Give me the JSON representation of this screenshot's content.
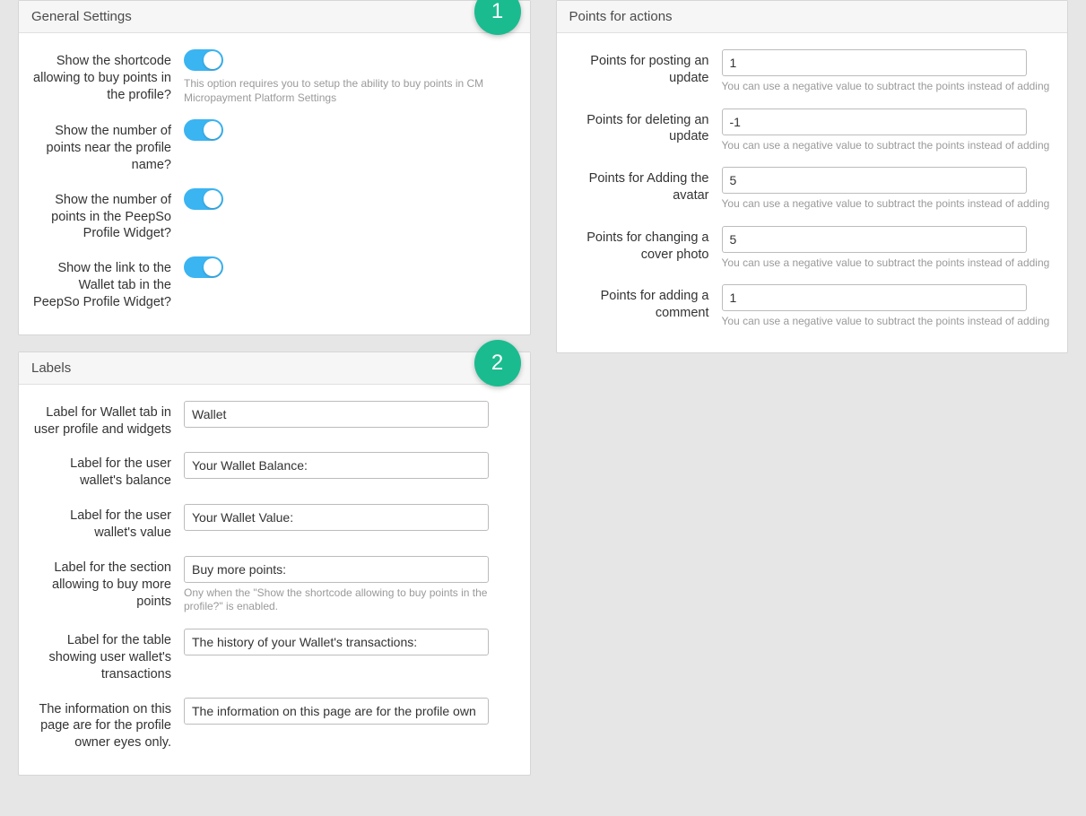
{
  "badges": {
    "one": "1",
    "two": "2"
  },
  "general": {
    "title": "General Settings",
    "items": [
      {
        "label": "Show the shortcode allowing to buy points in the profile?",
        "help": "This option requires you to setup the ability to buy points in CM Micropayment Platform Settings"
      },
      {
        "label": "Show the number of points near the profile name?",
        "help": ""
      },
      {
        "label": "Show the number of points in the PeepSo Profile Widget?",
        "help": ""
      },
      {
        "label": "Show the link to the Wallet tab in the PeepSo Profile Widget?",
        "help": ""
      }
    ]
  },
  "labels": {
    "title": "Labels",
    "items": [
      {
        "label": "Label for Wallet tab in user profile and widgets",
        "value": "Wallet",
        "help": ""
      },
      {
        "label": "Label for the user wallet's balance",
        "value": "Your Wallet Balance:",
        "help": ""
      },
      {
        "label": "Label for the user wallet's value",
        "value": "Your Wallet Value:",
        "help": ""
      },
      {
        "label": "Label for the section allowing to buy more points",
        "value": "Buy more points:",
        "help": "Ony when the \"Show the shortcode allowing to buy points in the profile?\" is enabled."
      },
      {
        "label": "Label for the table showing user wallet's transactions",
        "value": "The history of your Wallet's transactions:",
        "help": ""
      },
      {
        "label": "The information on this page are for the profile owner eyes only.",
        "value": "The information on this page are for the profile own",
        "help": ""
      }
    ]
  },
  "points": {
    "title": "Points for actions",
    "help": "You can use a negative value to subtract the points instead of adding",
    "items": [
      {
        "label": "Points for posting an update",
        "value": "1"
      },
      {
        "label": "Points for deleting an update",
        "value": "-1"
      },
      {
        "label": "Points for Adding the avatar",
        "value": "5"
      },
      {
        "label": "Points for changing a cover photo",
        "value": "5"
      },
      {
        "label": "Points for adding a comment",
        "value": "1"
      }
    ]
  }
}
